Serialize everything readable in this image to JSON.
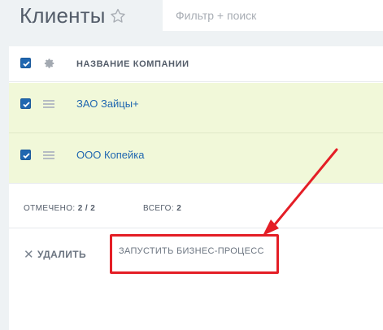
{
  "header": {
    "title": "Клиенты",
    "filter_placeholder": "Фильтр + поиск"
  },
  "grid": {
    "column_title": "НАЗВАНИЕ КОМПАНИИ",
    "rows": [
      {
        "name": "ЗАО Зайцы+",
        "checked": true
      },
      {
        "name": "ООО Копейка",
        "checked": true
      }
    ],
    "stats": {
      "selected_label": "ОТМЕЧЕНО:",
      "selected_value": "2 / 2",
      "total_label": "ВСЕГО:",
      "total_value": "2"
    }
  },
  "actions": {
    "delete_label": "УДАЛИТЬ",
    "run_bp_label": "ЗАПУСТИТЬ БИЗНЕС-ПРОЦЕСС"
  },
  "colors": {
    "accent": "#2067b0",
    "row_selected": "#f1f8d9",
    "annotation": "#e41e26"
  },
  "icons": [
    "star-icon",
    "gear-icon",
    "drag-handle-icon",
    "close-icon",
    "checkbox-checked-icon"
  ]
}
